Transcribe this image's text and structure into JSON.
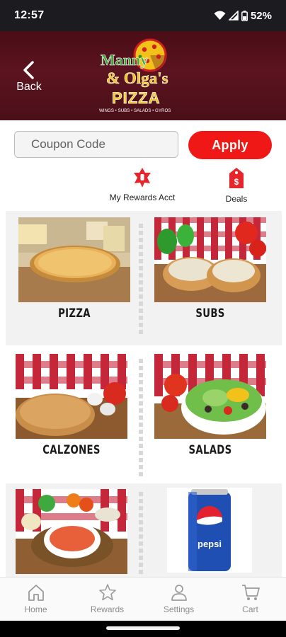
{
  "status_bar": {
    "time": "12:57",
    "battery": "52%"
  },
  "header": {
    "back_label": "Back",
    "logo": {
      "line1": "Manny",
      "line2": "& Olga's",
      "line3": "PIZZA",
      "tagline": "WINGS • SUBS • SALADS • GYROS"
    }
  },
  "coupon": {
    "placeholder": "Coupon Code",
    "value": "",
    "apply_label": "Apply"
  },
  "quick_links": [
    {
      "label": "My Rewards Acct",
      "icon": "rewards-badge-icon"
    },
    {
      "label": "Deals",
      "icon": "deals-tag-icon"
    }
  ],
  "categories": [
    {
      "label": "PIZZA"
    },
    {
      "label": "SUBS"
    },
    {
      "label": "CALZONES"
    },
    {
      "label": "SALADS"
    },
    {
      "label": ""
    },
    {
      "label": ""
    }
  ],
  "bottom_nav": [
    {
      "label": "Home",
      "icon": "home-icon"
    },
    {
      "label": "Rewards",
      "icon": "star-icon"
    },
    {
      "label": "Settings",
      "icon": "person-icon"
    },
    {
      "label": "Cart",
      "icon": "cart-icon"
    }
  ],
  "colors": {
    "header": "#5b1420",
    "accent": "#f01717",
    "nav_icon": "#9a9a9a"
  }
}
